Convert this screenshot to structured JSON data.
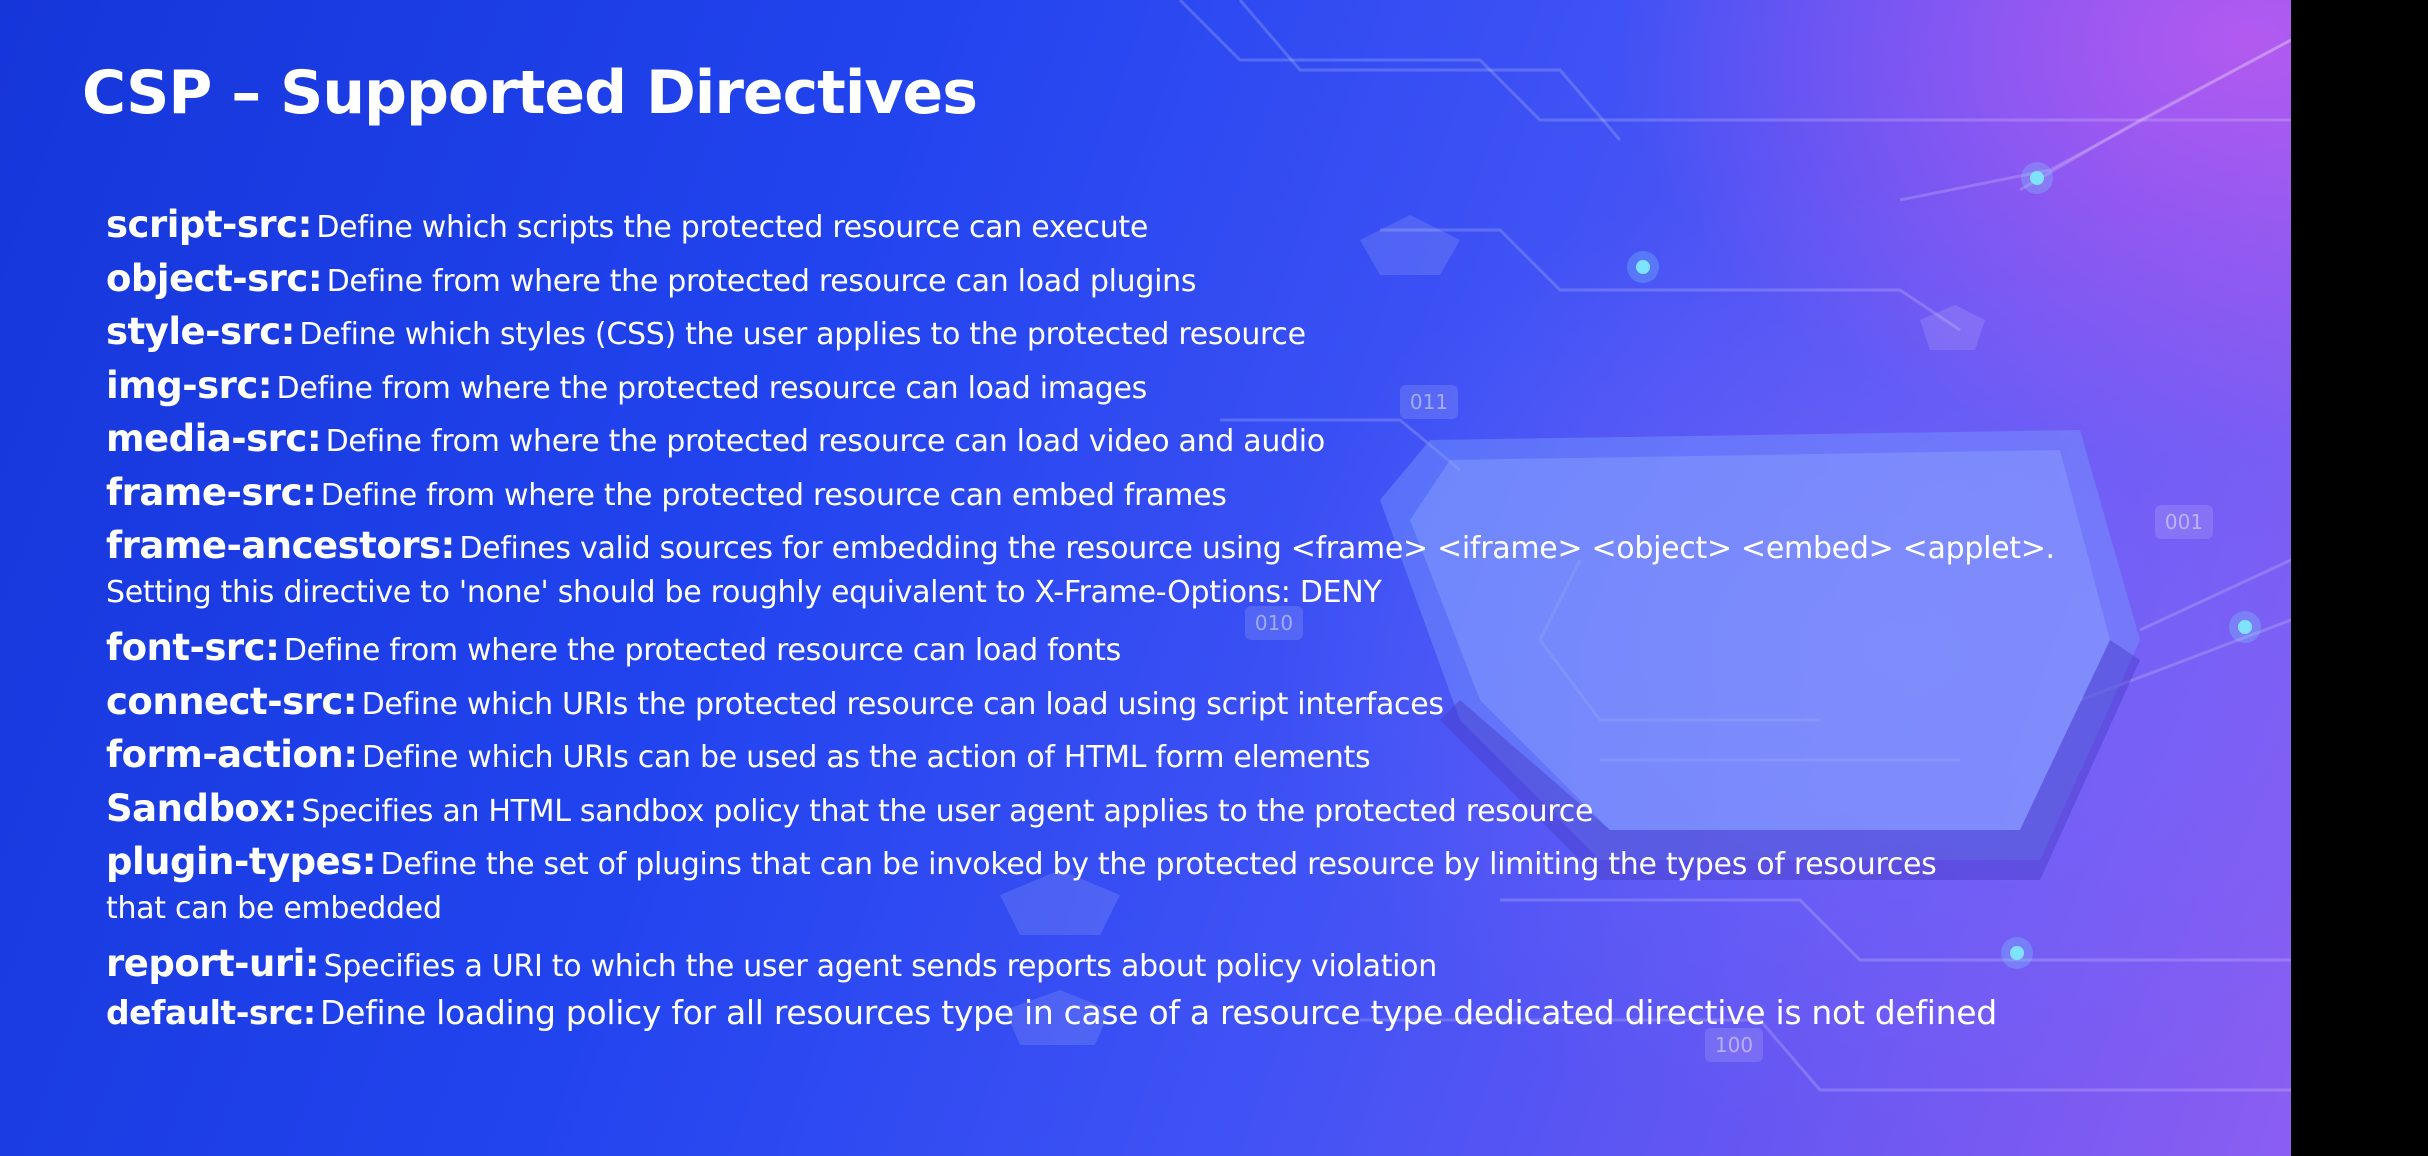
{
  "slide": {
    "title": "CSP – Supported Directives",
    "badges": [
      "011",
      "001",
      "010",
      "100"
    ],
    "directives": [
      {
        "term": "script-src:",
        "desc": "Define which scripts the protected resource can execute"
      },
      {
        "term": "object-src:",
        "desc": "Define from where the protected resource can load plugins"
      },
      {
        "term": "style-src:",
        "desc": "Define which styles (CSS) the user applies to the protected resource"
      },
      {
        "term": "img-src:",
        "desc": "Define from where the protected resource can load images"
      },
      {
        "term": "media-src:",
        "desc": "Define from where the protected resource can load video and audio"
      },
      {
        "term": "frame-src:",
        "desc": "Define from where the protected resource can embed frames"
      },
      {
        "term": "frame-ancestors:",
        "desc": "Defines valid sources for embedding the resource using <frame> <iframe> <object> <embed> <applet>.",
        "desc2": "Setting this directive to 'none' should be roughly equivalent to X-Frame-Options: DENY"
      },
      {
        "term": "font-src:",
        "desc": "Define from where the protected resource can load fonts"
      },
      {
        "term": "connect-src:",
        "desc": "Define which URIs the protected resource can load using script interfaces"
      },
      {
        "term": "form-action:",
        "desc": "Define which URIs can be used as the action of HTML form elements"
      },
      {
        "term": "Sandbox:",
        "desc": "Specifies an HTML sandbox policy that the user agent applies to the protected resource"
      },
      {
        "term": "plugin-types:",
        "desc": "Define the set of plugins that can be invoked by the protected resource by limiting the types of resources",
        "desc2": "that can be embedded"
      },
      {
        "term": "report-uri:",
        "desc": "Specifies a URI to which the user agent sends reports about policy violation"
      },
      {
        "term": "default-src:",
        "desc": "Define loading policy for all resources type in case of a resource type dedicated directive is not defined"
      }
    ]
  },
  "colors": {
    "text": "#ffffff",
    "gradient_start": "#1536d9",
    "gradient_end": "#8b5ef2"
  }
}
